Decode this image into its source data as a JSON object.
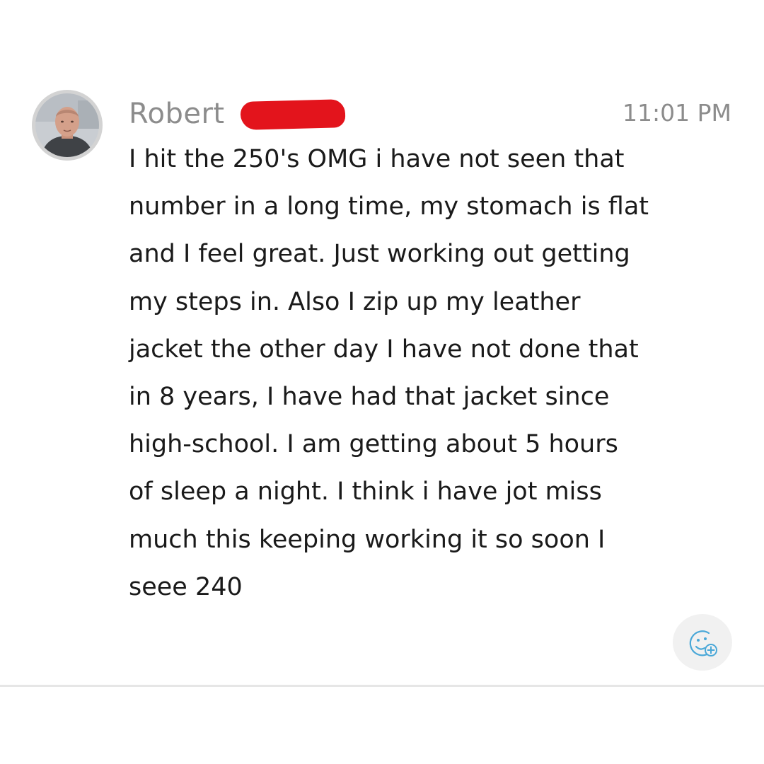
{
  "message": {
    "sender_name": "Robert",
    "timestamp": "11:01 PM",
    "body_lines": [
      "I hit the 250's OMG i have not seen that",
      "number in a long time, my stomach is flat",
      "and I feel great.  Just working out getting",
      "my steps in.  Also I zip up my leather",
      "jacket the other day I have not done that",
      "in 8 years, I have had that jacket since",
      "high-school.  I am getting about 5 hours",
      "of sleep a night.  I think i have jot miss",
      "much this keeping working it so soon I",
      "seee 240"
    ],
    "reaction_icon": "add-reaction-smiley-icon"
  },
  "colors": {
    "name_text": "#8c8c8c",
    "body_text": "#1a1a1a",
    "redaction": "#e3141c",
    "reaction_icon": "#4aa8d8",
    "reaction_bg": "#f1f1f1",
    "divider": "#e6e6e6"
  }
}
